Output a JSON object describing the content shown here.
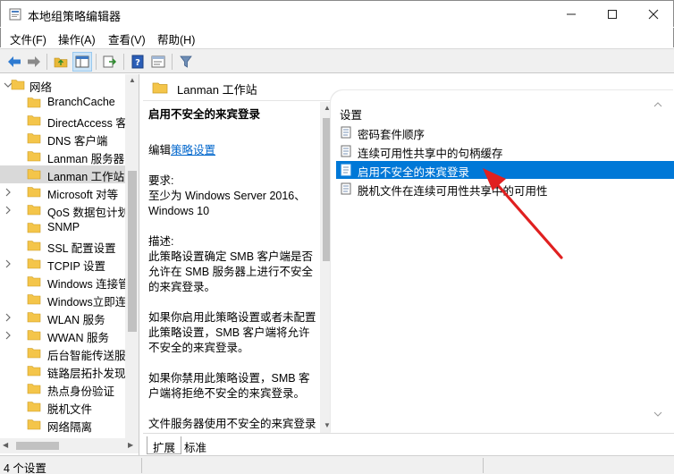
{
  "window": {
    "title": "本地组策略编辑器",
    "controls": [
      "minimize-icon",
      "maximize-icon",
      "close-icon"
    ]
  },
  "menubar": {
    "items": [
      "文件(F)",
      "操作(A)",
      "查看(V)",
      "帮助(H)"
    ]
  },
  "toolbar": {
    "buttons": [
      "back-arrow-icon",
      "forward-arrow-icon",
      "up-folder-icon",
      "show-hide-tree-icon",
      "export-list-icon",
      "help-icon",
      "properties-icon",
      "filter-icon"
    ]
  },
  "tree": {
    "items": [
      {
        "label": "网络",
        "expanded": true,
        "chevron": "expanded"
      },
      {
        "label": "BranchCache",
        "chevron": "none"
      },
      {
        "label": "DirectAccess 客",
        "chevron": "none"
      },
      {
        "label": "DNS 客户端",
        "chevron": "none"
      },
      {
        "label": "Lanman 服务器",
        "chevron": "none"
      },
      {
        "label": "Lanman 工作站",
        "chevron": "none",
        "selected": true
      },
      {
        "label": "Microsoft 对等",
        "chevron": "collapsed"
      },
      {
        "label": "QoS 数据包计划",
        "chevron": "collapsed"
      },
      {
        "label": "SNMP",
        "chevron": "none"
      },
      {
        "label": "SSL 配置设置",
        "chevron": "none"
      },
      {
        "label": "TCPIP 设置",
        "chevron": "collapsed"
      },
      {
        "label": "Windows 连接管",
        "chevron": "none"
      },
      {
        "label": "Windows立即连",
        "chevron": "none"
      },
      {
        "label": "WLAN 服务",
        "chevron": "collapsed"
      },
      {
        "label": "WWAN 服务",
        "chevron": "collapsed"
      },
      {
        "label": "后台智能传送服",
        "chevron": "none"
      },
      {
        "label": "链路层拓扑发现",
        "chevron": "none"
      },
      {
        "label": "热点身份验证",
        "chevron": "none"
      },
      {
        "label": "脱机文件",
        "chevron": "none"
      },
      {
        "label": "网络隔离",
        "chevron": "none"
      }
    ]
  },
  "right_panel": {
    "header": "Lanman 工作站",
    "description": {
      "policy_title": "启用不安全的来宾登录",
      "edit_prefix": "编辑",
      "edit_link": "策略设置",
      "requirements_label": "要求:",
      "requirements_text": "至少为 Windows Server 2016、Windows 10",
      "desc_label": "描述:",
      "paragraph1": "此策略设置确定 SMB 客户端是否允许在 SMB 服务器上进行不安全的来宾登录。",
      "paragraph2": "如果你启用此策略设置或者未配置此策略设置，SMB 客户端将允许不安全的来宾登录。",
      "paragraph3": "如果你禁用此策略设置，SMB 客户端将拒绝不安全的来宾登录。",
      "paragraph4": "文件服务器使用不安全的来宾登录来允许对共享文件夹进行未经身份"
    },
    "list": {
      "column_header": "设置",
      "items": [
        {
          "label": "密码套件顺序",
          "icon": "policy-setting-icon"
        },
        {
          "label": "连续可用性共享中的句柄缓存",
          "icon": "policy-setting-icon"
        },
        {
          "label": "启用不安全的来宾登录",
          "icon": "policy-setting-icon",
          "selected": true
        },
        {
          "label": "脱机文件在连续可用性共享中的可用性",
          "icon": "policy-setting-icon"
        }
      ]
    },
    "tabs": [
      "扩展",
      "标准"
    ],
    "active_tab": "扩展"
  },
  "statusbar": {
    "text": "4 个设置"
  },
  "colors": {
    "selection_blue": "#0078d7",
    "annotation_arrow": "#e02020",
    "folder_yellow": "#f4c54a",
    "link_blue": "#0066cc"
  }
}
